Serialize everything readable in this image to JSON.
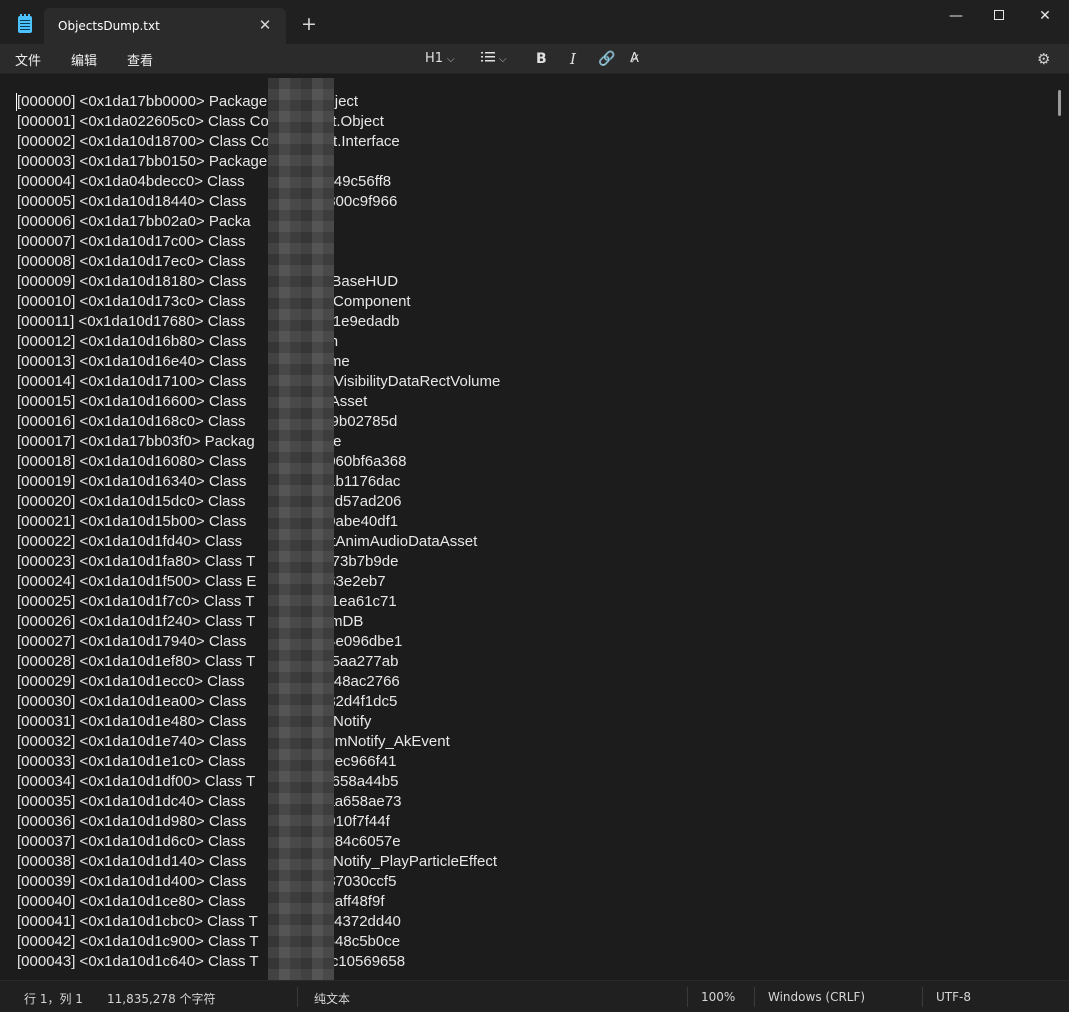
{
  "window": {
    "tab_title": "ObjectsDump.txt",
    "tab_close": "✕",
    "new_tab": "+",
    "minimize": "—",
    "close": "✕"
  },
  "menu": {
    "file": "文件",
    "edit": "编辑",
    "view": "查看"
  },
  "toolbar": {
    "heading": "H1",
    "dropdown_chevron": "⌵",
    "bold": "B",
    "italic": "I",
    "link": "🔗",
    "clear_format": "A̷",
    "settings": "⚙"
  },
  "editor": {
    "lines": [
      "[000000] <0x1da17bb0000> Package CoreUObject",
      "[000001] <0x1da022605c0> Class CoreUObject.Object",
      "[000002] <0x1da10d18700> Class CoreUObject.Interface",
      "[000003] <0x1da17bb0150> Package",
      "[000004] <0x1da04bdecc0> Class               .*7749c56ff8",
      "[000005] <0x1da10d18440> Class               .*2300c9f966",
      "[000006] <0x1da17bb02a0> Packa               e",
      "[000007] <0x1da10d17c00> Class               ctor",
      "[000008] <0x1da10d17ec0> Class               UD",
      "[000009] <0x1da10d18180> Class               .TslBaseHUD",
      "[000010] <0x1da10d173c0> Class               ctorComponent",
      "[000011] <0x1da10d17680> Class               .*cc1e9edadb",
      "[000012] <0x1da10d16b80> Class               rush",
      "[000013] <0x1da10d16e40> Class               olume",
      "[000014] <0x1da10d17100> Class               .ACVisibilityDataRectVolume",
      "[000015] <0x1da10d16600> Class               ataAsset",
      "[000016] <0x1da10d168c0> Class               .*af9b02785d",
      "[000017] <0x1da17bb03f0> Packag              dule",
      "[000018] <0x1da10d16080> Class               e.*060bf6a368",
      "[000019] <0x1da10d16340> Class               .*31b1176dac",
      "[000020] <0x1da10d15dc0> Class               .*96d57ad206",
      "[000021] <0x1da10d15b00> Class               .*d9abe40df1",
      "[000022] <0x1da10d1fd40> Class               CastAnimAudioDataAsset",
      "[000023] <0x1da10d1fa80> Class T             *d273b7b9de",
      "[000024] <0x1da10d1f500> Class E             3163e2eb7",
      "[000025] <0x1da10d1f7c0> Class T             *041ea61c71",
      "[000026] <0x1da10d1f240> Class T             AnimDB",
      "[000027] <0x1da10d17940> Class               .*64e096dbe1",
      "[000028] <0x1da10d1ef80> Class T             *a85aa277ab",
      "[000029] <0x1da10d1ecc0> Class               .*6e48ac2766",
      "[000030] <0x1da10d1ea00> Class               .*982d4f1dc5",
      "[000031] <0x1da10d1e480> Class               nimNotify",
      "[000032] <0x1da10d1e740> Class               .AnimNotify_AkEvent",
      "[000033] <0x1da10d1e1c0> Class               .*18ec966f41",
      "[000034] <0x1da10d1df00> Class T             *56658a44b5",
      "[000035] <0x1da10d1dc40> Class               .*8aa658ae73",
      "[000036] <0x1da10d1d980> Class               .*4910f7f44f",
      "[000037] <0x1da10d1d6c0> Class               .*7684c6057e",
      "[000038] <0x1da10d1d140> Class               nimNotify_PlayParticleEffect",
      "[000039] <0x1da10d1d400> Class               .*787030ccf5",
      "[000040] <0x1da10d1ce80> Class               .*80aff48f9f",
      "[000041] <0x1da10d1cbc0> Class T             *e34372dd40",
      "[000042] <0x1da10d1c900> Class T             *9648c5b0ce",
      "[000043] <0x1da10d1c640> Class T             .*4c10569658"
    ]
  },
  "status": {
    "position": "行 1，列 1",
    "char_count": "11,835,278 个字符",
    "format": "纯文本",
    "zoom": "100%",
    "line_ending": "Windows (CRLF)",
    "encoding": "UTF-8"
  }
}
